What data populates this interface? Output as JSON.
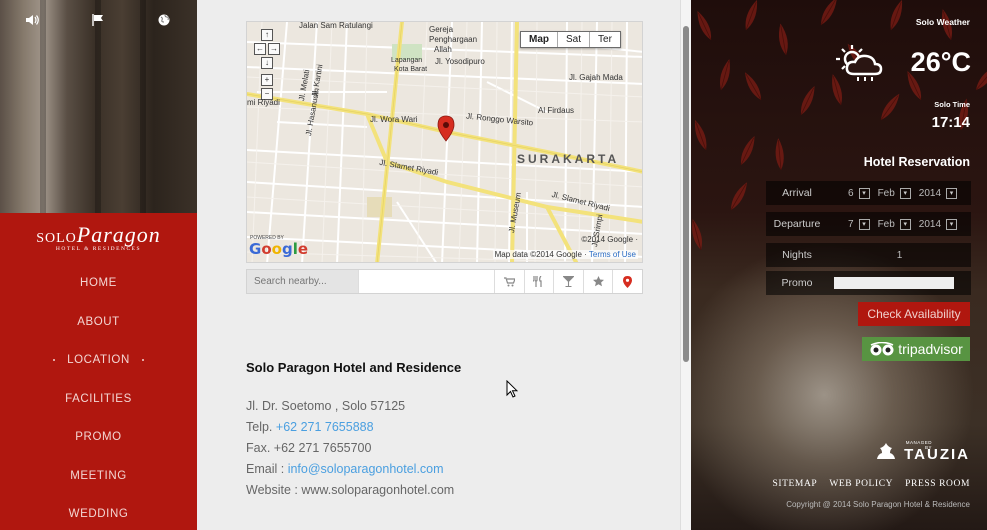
{
  "left": {
    "brand_main": "SOLO",
    "brand_accent": "Paragon",
    "brand_sub": "HOTEL & RESIDENCES",
    "nav": [
      "HOME",
      "ABOUT",
      "LOCATION",
      "FACILITIES",
      "PROMO",
      "MEETING",
      "WEDDING"
    ],
    "active_nav": "LOCATION",
    "icons": [
      "speaker-icon",
      "flag-icon",
      "globe-icon"
    ]
  },
  "map": {
    "types": [
      "Map",
      "Sat",
      "Ter"
    ],
    "active_type": "Map",
    "city": "SURAKARTA",
    "labels": [
      "Jalan Sam Ratulangi",
      "Gereja",
      "Penghargaan",
      "Allah",
      "Lapangan",
      "Kota Barat",
      "Jl. Yosodipuro",
      "Jl. Gajah Mada",
      "Jl. Melati",
      "Al Firdaus",
      "Jl. Wora Wari",
      "Jl. Ronggo Warsito",
      "Jl. Slamet Riyadi",
      "Jl. Slamet Riyadi",
      "Jl. Museum",
      "Jl. Srimpi",
      "Jl. Hasanudin",
      "Jl. Kartini",
      "mi Riyadi"
    ],
    "copyright": "©2014 Google ·",
    "attribution": "Map data ©2014 Google ·",
    "terms": "Terms of Use",
    "powered_by": "POWERED BY",
    "google": [
      "G",
      "o",
      "o",
      "g",
      "l",
      "e"
    ]
  },
  "nearby": {
    "placeholder": "Search nearby...",
    "buttons": [
      "cart-icon",
      "restaurant-icon",
      "cocktail-icon",
      "star-icon",
      "map-pin-icon"
    ]
  },
  "info": {
    "name": "Solo Paragon Hotel and Residence",
    "address": "Jl. Dr. Soetomo , Solo 57125",
    "tel_label": "Telp. ",
    "tel": "+62 271 7655888",
    "fax": "Fax. +62 271 7655700",
    "email_label": "Email : ",
    "email": "info@soloparagonhotel.com",
    "website": "Website : www.soloparagonhotel.com"
  },
  "right": {
    "weather_label": "Solo Weather",
    "temperature": "26°C",
    "time_label": "Solo Time",
    "time": "17:14",
    "reservation_title": "Hotel Reservation",
    "arrival_label": "Arrival",
    "arrival": {
      "day": "6",
      "month": "Feb",
      "year": "2014"
    },
    "departure_label": "Departure",
    "departure": {
      "day": "7",
      "month": "Feb",
      "year": "2014"
    },
    "nights_label": "Nights",
    "nights": "1",
    "promo_label": "Promo",
    "check_button": "Check Availability",
    "tripadvisor": "tripadvisor",
    "managed_by": "MANAGED BY",
    "tauzia": "TAUZIA",
    "footer_links": [
      "SITEMAP",
      "WEB POLICY",
      "PRESS ROOM"
    ],
    "copyright": "Copyright @ 2014 Solo Paragon Hotel & Residence"
  },
  "colors": {
    "brand_red": "#b0170f",
    "link_blue": "#4a9fe0",
    "tripadvisor_green": "#589442"
  }
}
